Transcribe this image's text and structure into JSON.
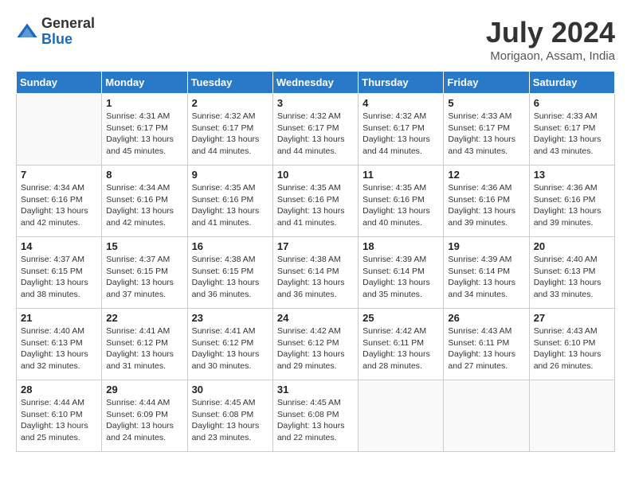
{
  "header": {
    "logo_general": "General",
    "logo_blue": "Blue",
    "month_title": "July 2024",
    "location": "Morigaon, Assam, India"
  },
  "calendar": {
    "days_of_week": [
      "Sunday",
      "Monday",
      "Tuesday",
      "Wednesday",
      "Thursday",
      "Friday",
      "Saturday"
    ],
    "weeks": [
      [
        {
          "day": "",
          "info": ""
        },
        {
          "day": "1",
          "info": "Sunrise: 4:31 AM\nSunset: 6:17 PM\nDaylight: 13 hours and 45 minutes."
        },
        {
          "day": "2",
          "info": "Sunrise: 4:32 AM\nSunset: 6:17 PM\nDaylight: 13 hours and 44 minutes."
        },
        {
          "day": "3",
          "info": "Sunrise: 4:32 AM\nSunset: 6:17 PM\nDaylight: 13 hours and 44 minutes."
        },
        {
          "day": "4",
          "info": "Sunrise: 4:32 AM\nSunset: 6:17 PM\nDaylight: 13 hours and 44 minutes."
        },
        {
          "day": "5",
          "info": "Sunrise: 4:33 AM\nSunset: 6:17 PM\nDaylight: 13 hours and 43 minutes."
        },
        {
          "day": "6",
          "info": "Sunrise: 4:33 AM\nSunset: 6:17 PM\nDaylight: 13 hours and 43 minutes."
        }
      ],
      [
        {
          "day": "7",
          "info": "Sunrise: 4:34 AM\nSunset: 6:16 PM\nDaylight: 13 hours and 42 minutes."
        },
        {
          "day": "8",
          "info": "Sunrise: 4:34 AM\nSunset: 6:16 PM\nDaylight: 13 hours and 42 minutes."
        },
        {
          "day": "9",
          "info": "Sunrise: 4:35 AM\nSunset: 6:16 PM\nDaylight: 13 hours and 41 minutes."
        },
        {
          "day": "10",
          "info": "Sunrise: 4:35 AM\nSunset: 6:16 PM\nDaylight: 13 hours and 41 minutes."
        },
        {
          "day": "11",
          "info": "Sunrise: 4:35 AM\nSunset: 6:16 PM\nDaylight: 13 hours and 40 minutes."
        },
        {
          "day": "12",
          "info": "Sunrise: 4:36 AM\nSunset: 6:16 PM\nDaylight: 13 hours and 39 minutes."
        },
        {
          "day": "13",
          "info": "Sunrise: 4:36 AM\nSunset: 6:16 PM\nDaylight: 13 hours and 39 minutes."
        }
      ],
      [
        {
          "day": "14",
          "info": "Sunrise: 4:37 AM\nSunset: 6:15 PM\nDaylight: 13 hours and 38 minutes."
        },
        {
          "day": "15",
          "info": "Sunrise: 4:37 AM\nSunset: 6:15 PM\nDaylight: 13 hours and 37 minutes."
        },
        {
          "day": "16",
          "info": "Sunrise: 4:38 AM\nSunset: 6:15 PM\nDaylight: 13 hours and 36 minutes."
        },
        {
          "day": "17",
          "info": "Sunrise: 4:38 AM\nSunset: 6:14 PM\nDaylight: 13 hours and 36 minutes."
        },
        {
          "day": "18",
          "info": "Sunrise: 4:39 AM\nSunset: 6:14 PM\nDaylight: 13 hours and 35 minutes."
        },
        {
          "day": "19",
          "info": "Sunrise: 4:39 AM\nSunset: 6:14 PM\nDaylight: 13 hours and 34 minutes."
        },
        {
          "day": "20",
          "info": "Sunrise: 4:40 AM\nSunset: 6:13 PM\nDaylight: 13 hours and 33 minutes."
        }
      ],
      [
        {
          "day": "21",
          "info": "Sunrise: 4:40 AM\nSunset: 6:13 PM\nDaylight: 13 hours and 32 minutes."
        },
        {
          "day": "22",
          "info": "Sunrise: 4:41 AM\nSunset: 6:12 PM\nDaylight: 13 hours and 31 minutes."
        },
        {
          "day": "23",
          "info": "Sunrise: 4:41 AM\nSunset: 6:12 PM\nDaylight: 13 hours and 30 minutes."
        },
        {
          "day": "24",
          "info": "Sunrise: 4:42 AM\nSunset: 6:12 PM\nDaylight: 13 hours and 29 minutes."
        },
        {
          "day": "25",
          "info": "Sunrise: 4:42 AM\nSunset: 6:11 PM\nDaylight: 13 hours and 28 minutes."
        },
        {
          "day": "26",
          "info": "Sunrise: 4:43 AM\nSunset: 6:11 PM\nDaylight: 13 hours and 27 minutes."
        },
        {
          "day": "27",
          "info": "Sunrise: 4:43 AM\nSunset: 6:10 PM\nDaylight: 13 hours and 26 minutes."
        }
      ],
      [
        {
          "day": "28",
          "info": "Sunrise: 4:44 AM\nSunset: 6:10 PM\nDaylight: 13 hours and 25 minutes."
        },
        {
          "day": "29",
          "info": "Sunrise: 4:44 AM\nSunset: 6:09 PM\nDaylight: 13 hours and 24 minutes."
        },
        {
          "day": "30",
          "info": "Sunrise: 4:45 AM\nSunset: 6:08 PM\nDaylight: 13 hours and 23 minutes."
        },
        {
          "day": "31",
          "info": "Sunrise: 4:45 AM\nSunset: 6:08 PM\nDaylight: 13 hours and 22 minutes."
        },
        {
          "day": "",
          "info": ""
        },
        {
          "day": "",
          "info": ""
        },
        {
          "day": "",
          "info": ""
        }
      ]
    ]
  }
}
